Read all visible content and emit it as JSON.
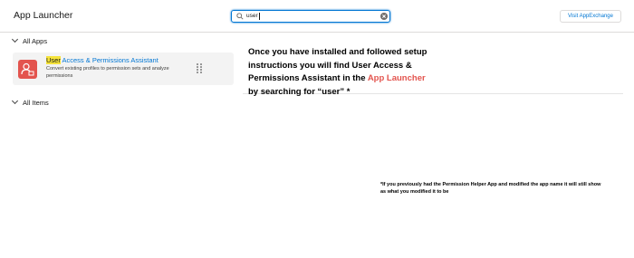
{
  "header": {
    "title": "App Launcher",
    "search": {
      "value": "user",
      "icon": "search-icon",
      "clear_icon": "clear-icon"
    },
    "appexchange_label": "Visit AppExchange"
  },
  "sections": {
    "all_apps": "All Apps",
    "all_items": "All Items"
  },
  "app_card": {
    "name_highlight": "User",
    "name_rest": " Access & Permissions Assistant",
    "description": "Convert existing profiles to permission sets and analyze permissions",
    "icon": "app-people-icon",
    "icon_color": "#e3544e"
  },
  "callout": {
    "line1": "Once you have installed and followed setup instructions you will find User Access & Permissions Assistant in the ",
    "highlight": "App Launcher",
    "line2": " by searching for “user” *"
  },
  "footnote": "*If you previously had the Permission Helper App and modified the app name it will still show as what you modified it to be",
  "colors": {
    "accent": "#0176d3",
    "highlight": "#f5e33a",
    "callout_red": "#e3544e"
  }
}
